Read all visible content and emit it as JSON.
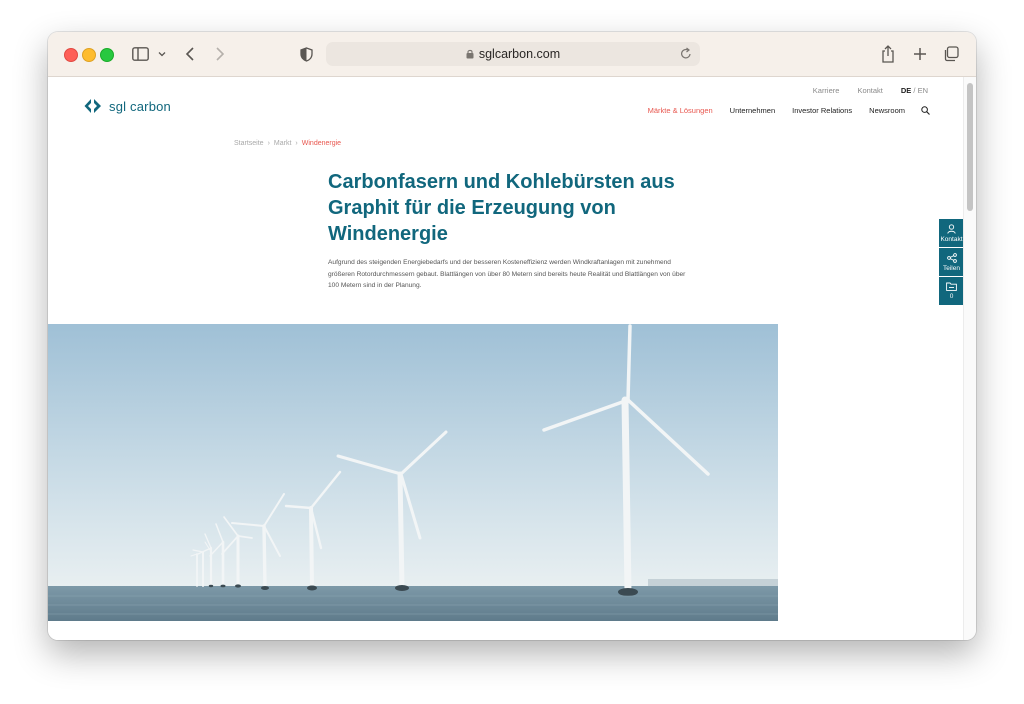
{
  "browser": {
    "url": "sglcarbon.com"
  },
  "header": {
    "logo_text": "sgl carbon",
    "top_links": {
      "karriere": "Karriere",
      "kontakt": "Kontakt",
      "lang_de": "DE",
      "lang_sep": " / ",
      "lang_en": "EN"
    },
    "nav": [
      "Märkte & Lösungen",
      "Unternehmen",
      "Investor Relations",
      "Newsroom"
    ],
    "nav_active_index": 0
  },
  "breadcrumb": {
    "items": [
      "Startseite",
      "Markt",
      "Windenergie"
    ],
    "separator": "›"
  },
  "main": {
    "headline": "Carbonfasern und Kohlebürsten aus Graphit für die Erzeugung von Windenergie",
    "intro": "Aufgrund des steigenden Energiebedarfs und der besseren Kosteneffizienz werden Windkraftanlagen mit zunehmend größeren Rotordurchmessern gebaut. Blattlängen von über 80 Metern sind bereits heute Realität und Blattlängen von über 100 Metern sind in der Planung."
  },
  "side_tools": {
    "kontakt": "Kontakt",
    "teilen": "Teilen",
    "folder_count": "0"
  },
  "colors": {
    "brand": "#11677d",
    "accent": "#e8574f"
  },
  "icons": [
    "sidebar-toggle-icon",
    "chevron-down-icon",
    "back-icon",
    "forward-icon",
    "shield-icon",
    "lock-icon",
    "reload-icon",
    "share-icon",
    "new-tab-icon",
    "tabs-icon",
    "search-icon",
    "user-icon",
    "share-nodes-icon",
    "folder-icon"
  ]
}
